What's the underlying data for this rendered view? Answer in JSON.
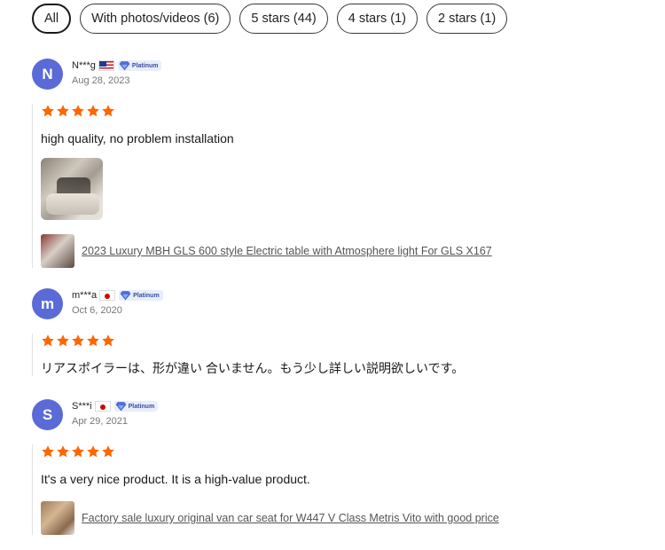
{
  "filters": [
    {
      "label": "All",
      "active": true
    },
    {
      "label": "With photos/videos (6)",
      "active": false
    },
    {
      "label": "5 stars (44)",
      "active": false
    },
    {
      "label": "4 stars (1)",
      "active": false
    },
    {
      "label": "2 stars (1)",
      "active": false
    }
  ],
  "colors": {
    "star": "#ff6600",
    "avatar": "#5a6ad6",
    "badge_text": "#3a4d9e"
  },
  "reviews": [
    {
      "initial": "N",
      "name": "N***g",
      "flag": "us",
      "badge": "Platinum",
      "date": "Aug 28, 2023",
      "rating": 5,
      "text": "high quality, no problem installation",
      "has_photo": true,
      "product": "2023 Luxury MBH GLS 600 style Electric table with Atmosphere light For GLS X167"
    },
    {
      "initial": "m",
      "name": "m***a",
      "flag": "jp",
      "badge": "Platinum",
      "date": "Oct 6, 2020",
      "rating": 5,
      "text": "リアスポイラーは、形が違い 合いません。もう少し詳しい説明欲しいです。",
      "has_photo": false,
      "product": ""
    },
    {
      "initial": "S",
      "name": "S***i",
      "flag": "jp",
      "badge": "Platinum",
      "date": "Apr 29, 2021",
      "rating": 5,
      "text": "It's a very nice product. It is a high-value product.",
      "has_photo": false,
      "product": "Factory sale luxury original van car seat for W447 V Class Metris Vito with good price"
    }
  ]
}
